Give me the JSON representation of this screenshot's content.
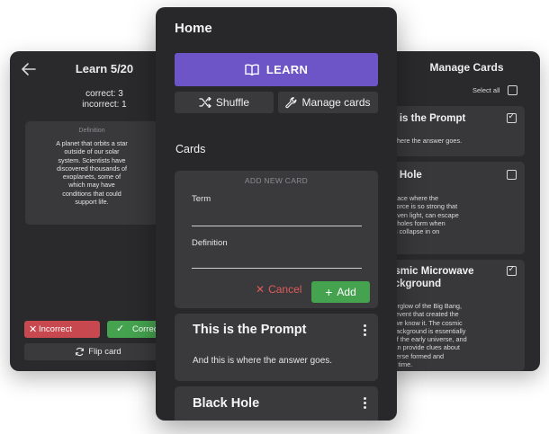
{
  "learn_screen": {
    "title": "Learn 5/20",
    "correct_text": "correct: 3",
    "incorrect_text": "incorrect: 1",
    "card_label": "Definition",
    "definition_lines": [
      "A planet that orbits a star",
      "outside of our solar",
      "system. Scientists have",
      "discovered thousands of",
      "exoplanets, some of",
      "which may have",
      "conditions that could",
      "support life."
    ],
    "incorrect_button": "Incorrect",
    "correct_button": "Correct",
    "flip_button": "Flip card"
  },
  "home_screen": {
    "title": "Home",
    "learn_button": "LEARN",
    "shuffle_button": "Shuffle",
    "manage_button": "Manage cards",
    "cards_heading": "Cards",
    "new_card": {
      "title": "ADD NEW CARD",
      "term_label": "Term",
      "definition_label": "Definition",
      "cancel_button": "Cancel",
      "add_button": "Add"
    },
    "cards": [
      {
        "title": "This is the Prompt",
        "text": "And this is where the answer goes."
      },
      {
        "title": "Black Hole",
        "text": ""
      }
    ]
  },
  "manage_screen": {
    "title": "Manage Cards",
    "select_all": "Select all",
    "cards": [
      {
        "title": "This is the Prompt",
        "lines": [
          "And this is where the answer goes."
        ],
        "checked": true
      },
      {
        "title": "Black Hole",
        "lines": [
          "A region in space where the",
          "gravitational force is so strong that",
          "nothing, not even light, can escape",
          "from it. Black holes form when",
          "massive stars collapse in on",
          "themselves."
        ],
        "checked": false
      },
      {
        "title": "Cosmic Microwave Background",
        "title_lines": [
          "Cosmic Microwave",
          "Background"
        ],
        "lines": [
          "The faint afterglow of the Big Bang,",
          "which is the event that created the",
          "universe as we know it. The cosmic",
          "microwave background is essentially",
          "a snapshot of the early universe, and",
          "studying it can provide clues about",
          "how the universe formed and",
          "evolved over time."
        ],
        "checked": true
      }
    ]
  },
  "colors": {
    "panel_bg": "#28282b",
    "card_bg": "#3a3a3d",
    "accent_purple": "#6d55c8",
    "success_green": "#45a34f",
    "danger_red": "#c8484f",
    "cancel_red": "#e05a5a"
  },
  "icons": {
    "back": "arrow-left-icon",
    "book": "book-open-icon",
    "shuffle": "shuffle-icon",
    "wrench": "wrench-icon",
    "flip": "refresh-icon",
    "more": "kebab-menu-icon"
  }
}
